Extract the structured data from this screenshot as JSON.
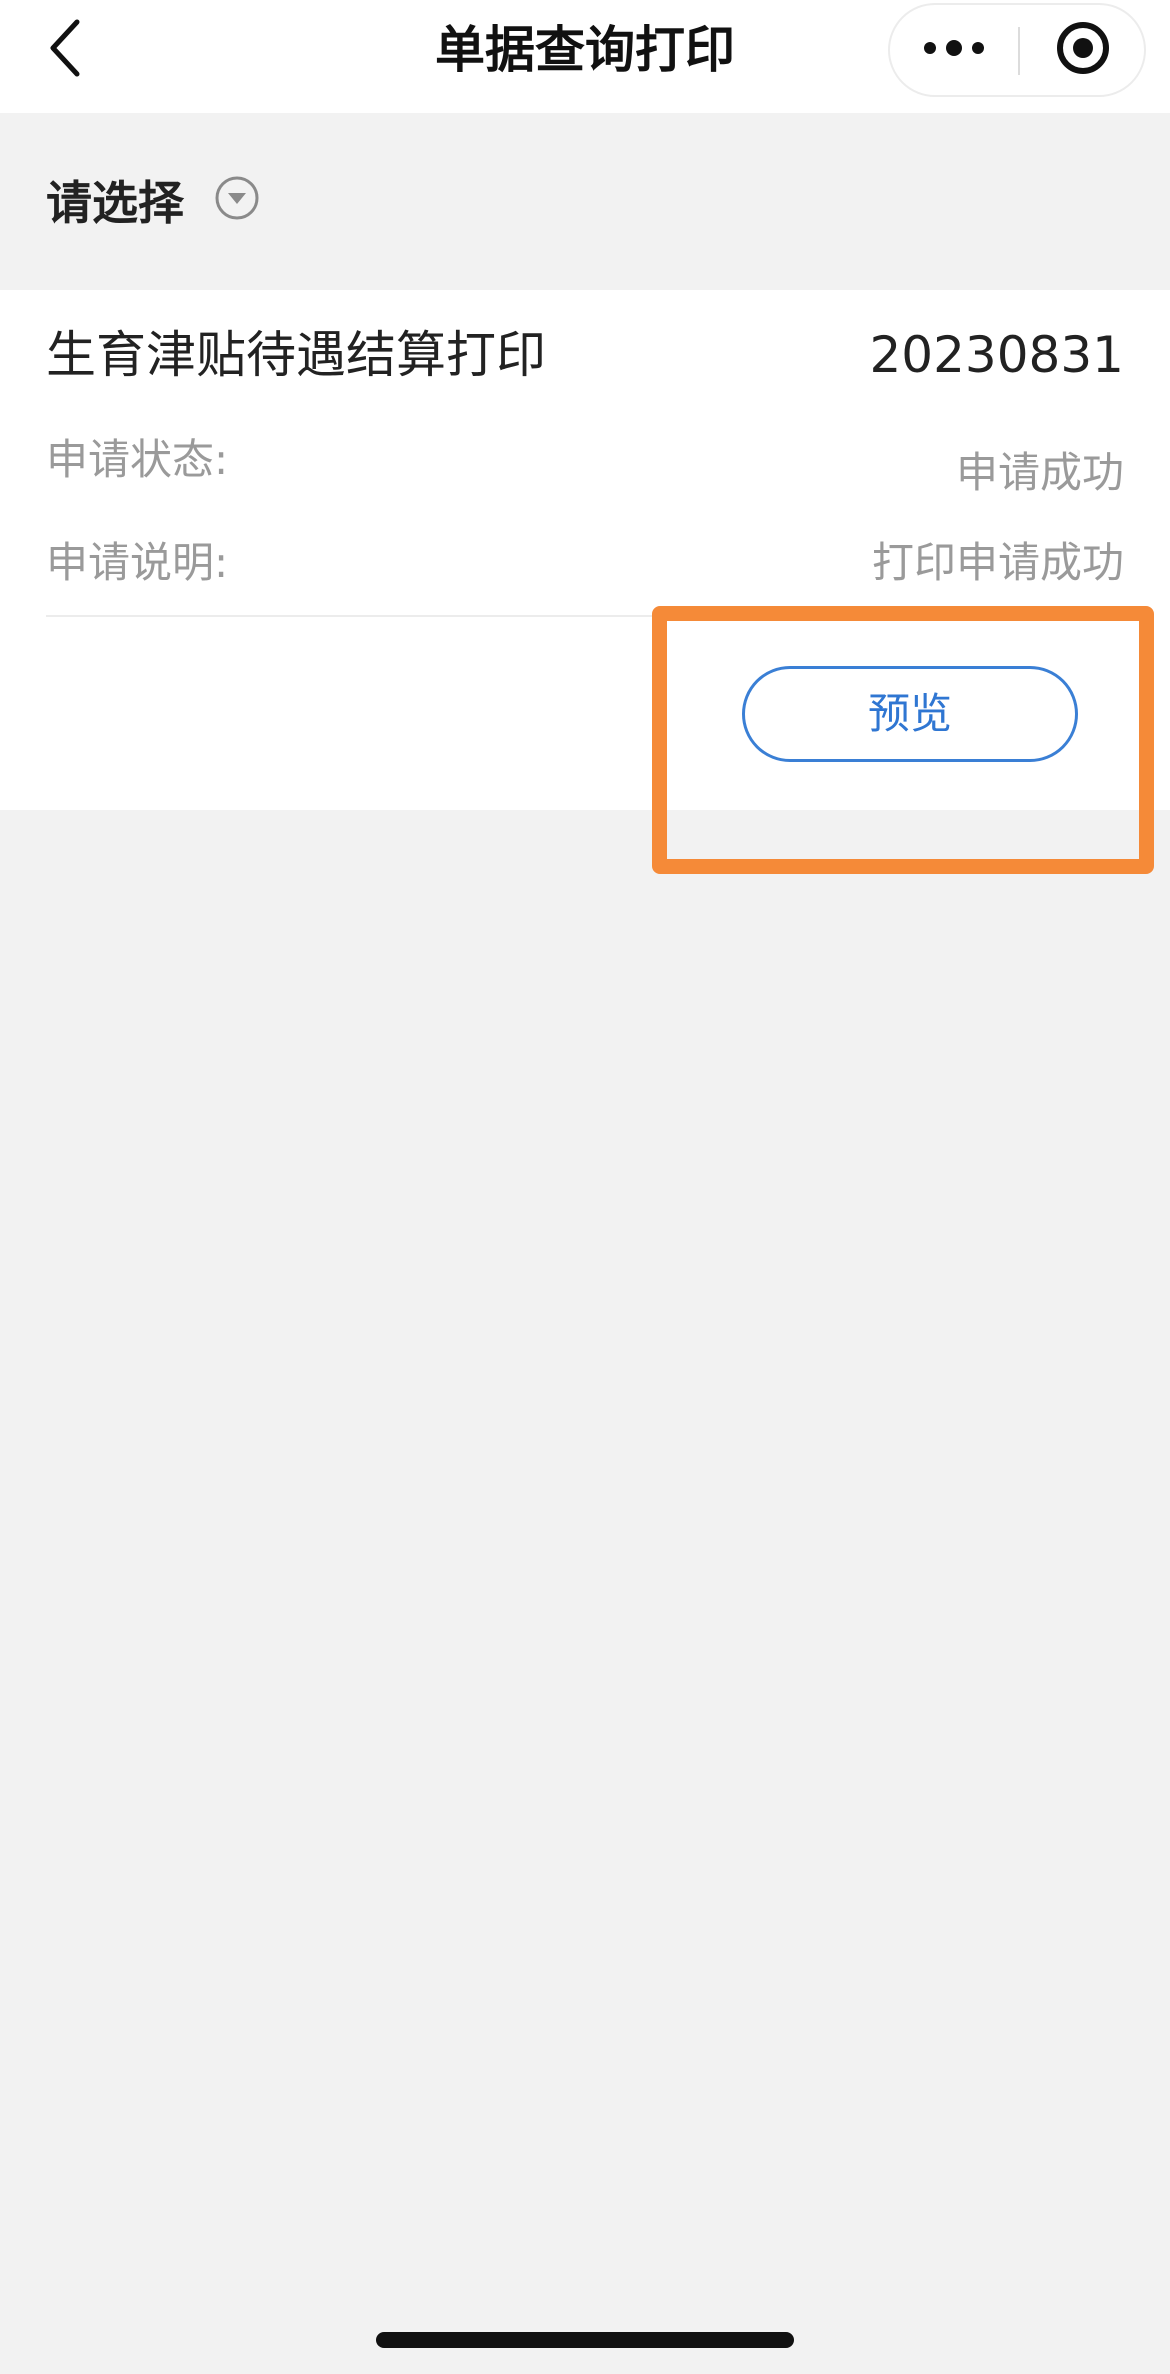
{
  "navbar": {
    "title": "单据查询打印",
    "back_icon": "chevron-left-icon",
    "more_icon": "more-dots-icon",
    "close_icon": "target-circle-icon"
  },
  "filter": {
    "label": "请选择",
    "icon": "dropdown-circle-icon"
  },
  "record": {
    "title": "生育津贴待遇结算打印",
    "date": "20230831",
    "fields": [
      {
        "label": "申请状态:",
        "value": "申请成功"
      },
      {
        "label": "申请说明:",
        "value": "打印申请成功"
      }
    ],
    "preview_label": "预览"
  },
  "colors": {
    "accent_blue": "#2f76d2",
    "highlight_orange": "#f58a38",
    "background": "#f2f2f2"
  }
}
